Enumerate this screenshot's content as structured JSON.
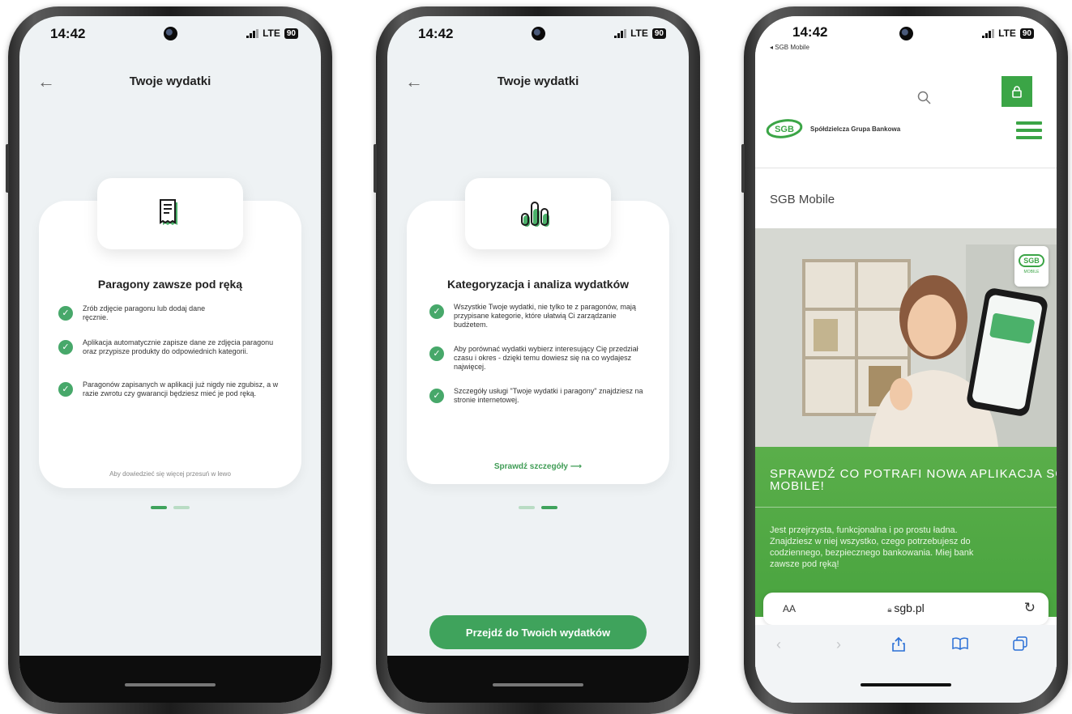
{
  "status": {
    "time": "14:42",
    "network": "LTE",
    "battery": "90"
  },
  "header": {
    "title": "Twoje wydatki"
  },
  "screen1": {
    "card_title": "Paragony zawsze pod ręką",
    "bullets": [
      "Zrób zdjęcie paragonu lub dodaj dane ręcznie.",
      "Aplikacja automatycznie zapisze dane ze zdjęcia paragonu oraz przypisze produkty do odpowiednich kategorii.",
      "Paragonów zapisanych w aplikacji już nigdy nie zgubisz, a w razie zwrotu czy gwarancji będziesz mieć je pod ręką."
    ],
    "hint": "Aby dowiedzieć się więcej przesuń w lewo"
  },
  "screen2": {
    "card_title": "Kategoryzacja i analiza wydatków",
    "bullets": [
      "Wszystkie Twoje wydatki, nie tylko te z paragonów, mają przypisane kategorie, które ułatwią Ci zarządzanie budżetem.",
      "Aby porównać wydatki wybierz interesujący Cię przedział czasu i okres - dzięki temu dowiesz się na co wydajesz najwięcej.",
      "Szczegóły usługi \"Twoje wydatki i paragony\" znajdziesz na stronie internetowej."
    ],
    "link": "Sprawdź szczegóły ⟶",
    "cta": "Przejdź do Twoich wydatków"
  },
  "screen3": {
    "back_label": "◂ SGB Mobile",
    "logo_text": "SGB",
    "bank_name": "Spółdzielcza Grupa Bankowa",
    "page_heading": "SGB Mobile",
    "badge_logo": "SGB",
    "badge_sub": "MOBILE",
    "promo_title": "SPRAWDŹ CO POTRAFI NOWA APLIKACJA SGB MOBILE!",
    "promo_text": "Jest przejrzysta, funkcjonalna i po prostu ładna. Znajdziesz w niej wszystko, czego potrzebujesz do codziennego, bezpiecznego bankowania. Miej bank zawsze pod ręką!",
    "aa": "AA",
    "url": "sgb.pl"
  },
  "colors": {
    "accent": "#3fa35c",
    "check": "#47a86a",
    "brand": "#3ba546"
  },
  "icons": [
    "back-arrow-icon",
    "receipt-icon",
    "bar-chart-icon",
    "check-icon",
    "search-icon",
    "lock-icon",
    "hamburger-menu-icon",
    "reload-icon",
    "share-icon",
    "bookmarks-icon",
    "tabs-icon"
  ]
}
